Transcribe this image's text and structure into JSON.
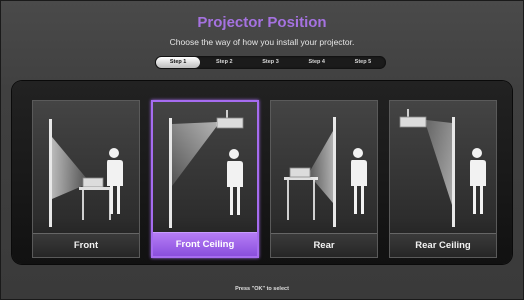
{
  "header": {
    "title": "Projector Position",
    "subtitle": "Choose the way of how you install your projector."
  },
  "steps": [
    {
      "label": "Step 1",
      "active": true
    },
    {
      "label": "Step 2",
      "active": false
    },
    {
      "label": "Step 3",
      "active": false
    },
    {
      "label": "Step 4",
      "active": false
    },
    {
      "label": "Step 5",
      "active": false
    }
  ],
  "options": [
    {
      "label": "Front",
      "selected": false,
      "icon": "front-table-projector-icon"
    },
    {
      "label": "Front Ceiling",
      "selected": true,
      "icon": "front-ceiling-projector-icon"
    },
    {
      "label": "Rear",
      "selected": false,
      "icon": "rear-table-projector-icon"
    },
    {
      "label": "Rear Ceiling",
      "selected": false,
      "icon": "rear-ceiling-projector-icon"
    }
  ],
  "footer": {
    "hint": "Press \"OK\" to select"
  },
  "colors": {
    "accent": "#a572e0",
    "selected_border": "#a66cf0"
  }
}
